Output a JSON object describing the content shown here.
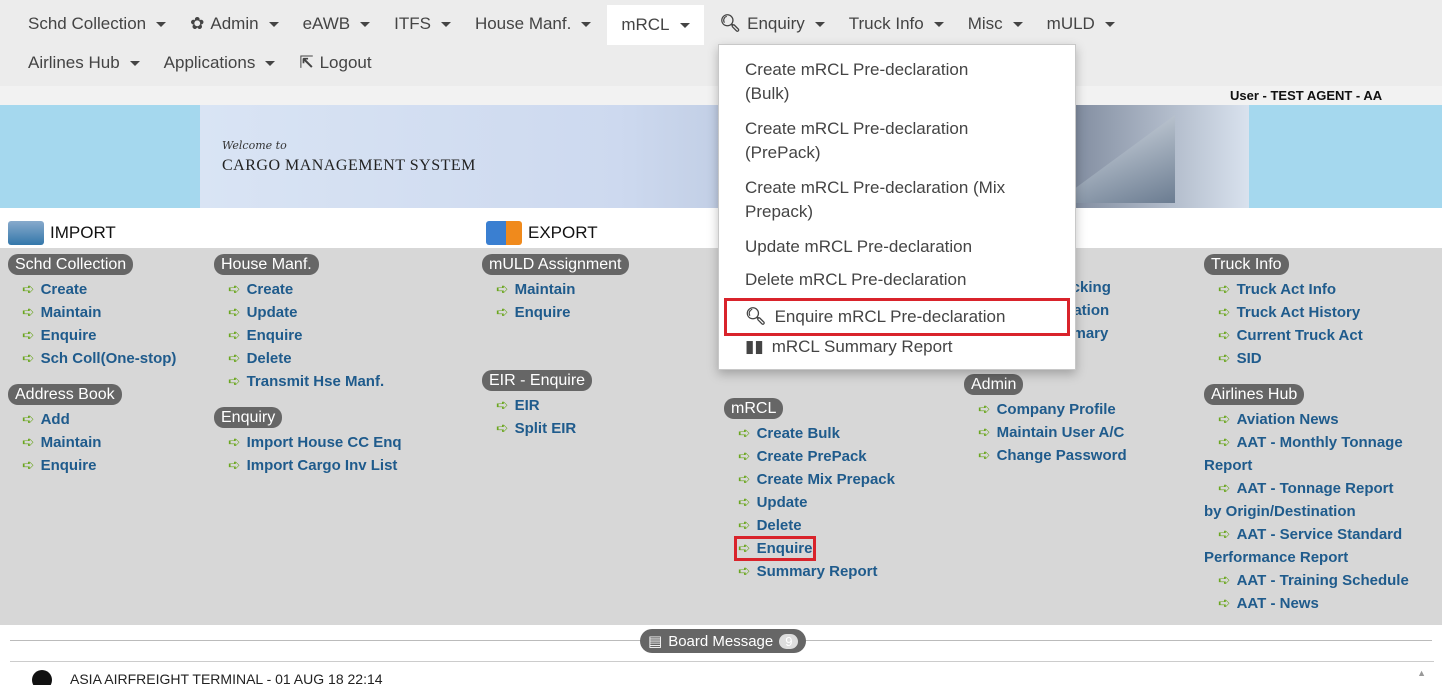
{
  "nav": {
    "row1": [
      {
        "label": "Schd Collection",
        "caret": true,
        "icon": ""
      },
      {
        "label": "Admin",
        "caret": true,
        "icon": "gear-icon"
      },
      {
        "label": "eAWB",
        "caret": true,
        "icon": ""
      },
      {
        "label": "ITFS",
        "caret": true,
        "icon": ""
      },
      {
        "label": "House Manf.",
        "caret": true,
        "icon": ""
      },
      {
        "label": "mRCL",
        "caret": true,
        "icon": "",
        "active": true
      },
      {
        "label": "Enquiry",
        "caret": true,
        "icon": "search-icon"
      },
      {
        "label": "Truck Info",
        "caret": true,
        "icon": ""
      },
      {
        "label": "Misc",
        "caret": true,
        "icon": ""
      },
      {
        "label": "mULD",
        "caret": true,
        "icon": ""
      }
    ],
    "row2": [
      {
        "label": "Airlines Hub",
        "caret": true
      },
      {
        "label": "Applications",
        "caret": true
      },
      {
        "label": "Logout",
        "icon": "logout-icon"
      }
    ]
  },
  "user": "User - TEST AGENT - AA",
  "banner": {
    "welcome": "Welcome to",
    "title": "CARGO MANAGEMENT SYSTEM"
  },
  "sections": {
    "import": "IMPORT",
    "export": "EXPORT"
  },
  "dropdown": {
    "items": [
      "Create mRCL Pre-declaration",
      "(Bulk)",
      "Create mRCL Pre-declaration",
      "(PrePack)",
      "Create mRCL Pre-declaration (Mix",
      "Prepack)",
      "Update mRCL Pre-declaration",
      "Delete mRCL Pre-declaration",
      "Enquire mRCL Pre-declaration",
      "mRCL Summary Report"
    ]
  },
  "import": {
    "schd": {
      "title": "Schd Collection",
      "links": [
        "Create",
        "Maintain",
        "Enquire",
        "Sch Coll(One-stop)"
      ]
    },
    "address": {
      "title": "Address Book",
      "links": [
        "Add",
        "Maintain",
        "Enquire"
      ]
    },
    "house": {
      "title": "House Manf.",
      "links": [
        "Create",
        "Update",
        "Enquire",
        "Delete",
        "Transmit Hse Manf."
      ]
    },
    "enquiry": {
      "title": "Enquiry",
      "links": [
        "Import House CC Enq",
        "Import Cargo Inv List"
      ]
    }
  },
  "export": {
    "muld": {
      "title": "mULD Assignment",
      "links": [
        "Maintain",
        "Enquire"
      ]
    },
    "eir": {
      "title": "EIR - Enquire",
      "links": [
        "EIR",
        "Split EIR"
      ]
    },
    "mrcl": {
      "title": "mRCL",
      "links": [
        "Create Bulk",
        "Create PrePack",
        "Create Mix Prepack",
        "Update",
        "Delete",
        "Enquire",
        "Summary Report"
      ]
    },
    "partial": [
      "t Tracking",
      "formation",
      "Summary"
    ],
    "admin": {
      "title": "Admin",
      "links": [
        "Company Profile",
        "Maintain User A/C",
        "Change Password"
      ]
    }
  },
  "truck": {
    "title": "Truck Info",
    "links": [
      "Truck Act Info",
      "Truck Act History",
      "Current Truck Act",
      "SID"
    ]
  },
  "airlines": {
    "title": "Airlines Hub",
    "links": [
      "Aviation News",
      "AAT - Monthly Tonnage",
      "Report",
      "AAT - Tonnage Report",
      "by Origin/Destination",
      "AAT - Service Standard",
      "Performance Report",
      "AAT - Training Schedule",
      "AAT - News"
    ]
  },
  "board": {
    "label": "Board Message",
    "count": "9",
    "first_item": "ASIA AIRFREIGHT TERMINAL - 01 AUG 18 22:14"
  },
  "colors": {
    "accent": "#d9232b",
    "link": "#1f5b8c",
    "arrow": "#6aa61e"
  }
}
